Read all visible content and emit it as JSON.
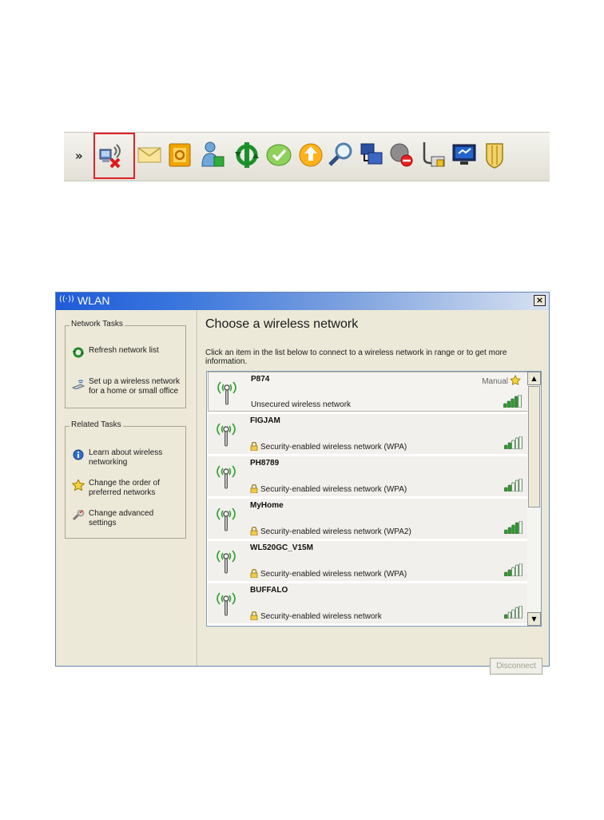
{
  "tray": {
    "chevron": "»",
    "icons": [
      "wireless-disconnected-icon",
      "mail-icon",
      "outlook-icon",
      "user-status-icon",
      "sync-icon",
      "check-icon",
      "update-arrow-icon",
      "search-icon",
      "network-computers-icon",
      "shield-blocked-icon",
      "network-printer-icon",
      "monitor-icon",
      "security-shield-icon"
    ]
  },
  "window": {
    "title": "WLAN",
    "close": "×"
  },
  "network_tasks": {
    "title": "Network Tasks",
    "items": [
      {
        "label": "Refresh network list",
        "icon": "refresh-icon"
      },
      {
        "label": "Set up a wireless network\nfor a home or small office",
        "icon": "wireless-setup-icon"
      }
    ]
  },
  "related_tasks": {
    "title": "Related Tasks",
    "items": [
      {
        "label": "Learn about wireless\nnetworking",
        "icon": "info-icon"
      },
      {
        "label": "Change the order of\npreferred networks",
        "icon": "star-icon"
      },
      {
        "label": "Change advanced\nsettings",
        "icon": "wrench-icon"
      }
    ]
  },
  "main": {
    "heading": "Choose a wireless network",
    "instruction": "Click an item in the list below to connect to a wireless network in range or to get more information."
  },
  "networks": [
    {
      "ssid": "P874",
      "security": "Unsecured wireless network",
      "secured": false,
      "signal_bars": 4,
      "manual_label": "Manual"
    },
    {
      "ssid": "FIGJAM",
      "security": "Security-enabled wireless network (WPA)",
      "secured": true,
      "signal_bars": 2
    },
    {
      "ssid": "PH8789",
      "security": "Security-enabled wireless network (WPA)",
      "secured": true,
      "signal_bars": 2
    },
    {
      "ssid": "MyHome",
      "security": "Security-enabled wireless network (WPA2)",
      "secured": true,
      "signal_bars": 4
    },
    {
      "ssid": "WL520GC_V15M",
      "security": "Security-enabled wireless network (WPA)",
      "secured": true,
      "signal_bars": 2
    },
    {
      "ssid": "BUFFALO",
      "security": "Security-enabled wireless network",
      "secured": true,
      "signal_bars": 1
    }
  ],
  "scrollbar": {
    "up": "▲",
    "down": "▼"
  },
  "buttons": {
    "disconnect": "Disconnect"
  },
  "colors": {
    "highlight_box": "#e0202a",
    "titlebar": "#1f5bd8",
    "signal_green": "#2aa02a",
    "signal_empty": "#ffffff"
  }
}
